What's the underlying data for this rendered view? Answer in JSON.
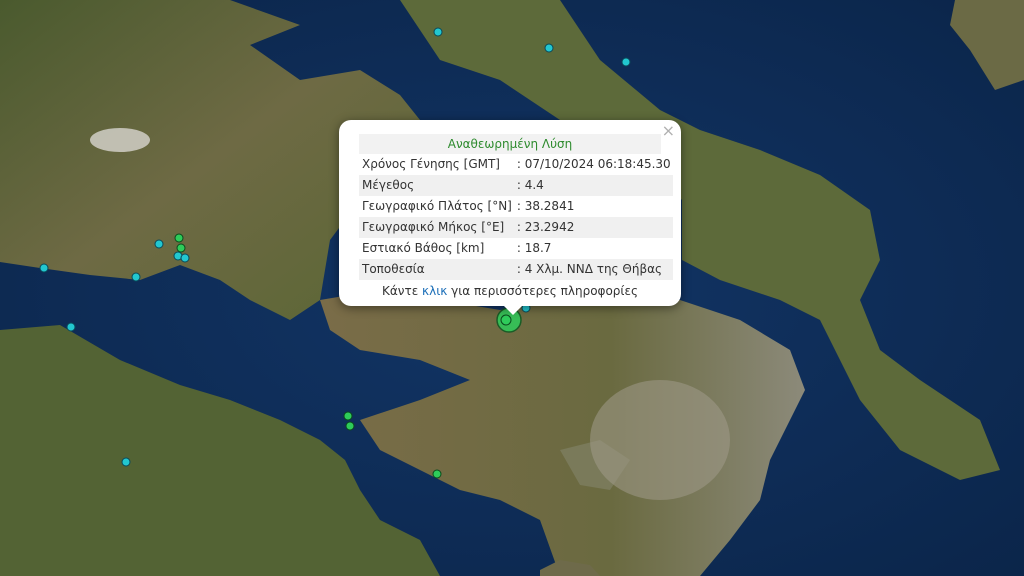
{
  "popup": {
    "title": "Αναθεωρημένη Λύση",
    "close_symbol": "×",
    "rows": [
      {
        "label": "Χρόνος Γένησης [GMT]",
        "value": ": 07/10/2024 06:18:45.30"
      },
      {
        "label": "Μέγεθος",
        "value": ": 4.4"
      },
      {
        "label": "Γεωγραφικό Πλάτος [°N]",
        "value": ": 38.2841"
      },
      {
        "label": "Γεωγραφικό Μήκος [°E]",
        "value": ": 23.2942"
      },
      {
        "label": "Εστιακό Βάθος [km]",
        "value": ": 18.7"
      },
      {
        "label": "Τοποθεσία",
        "value": ": 4 Χλμ. ΝΝΔ της Θήβας"
      }
    ],
    "footer_prefix": "Κάντε ",
    "footer_link": "κλικ",
    "footer_suffix": " για περισσότερες πληροφορίες"
  },
  "map": {
    "colors": {
      "sea": "#0e2a4e",
      "land": "#5c6b3c",
      "marker_green": "#2ecc5a",
      "marker_cyan": "#22c7d0"
    },
    "icons": {
      "close": "close-icon",
      "marker": "earthquake-marker-icon"
    }
  }
}
